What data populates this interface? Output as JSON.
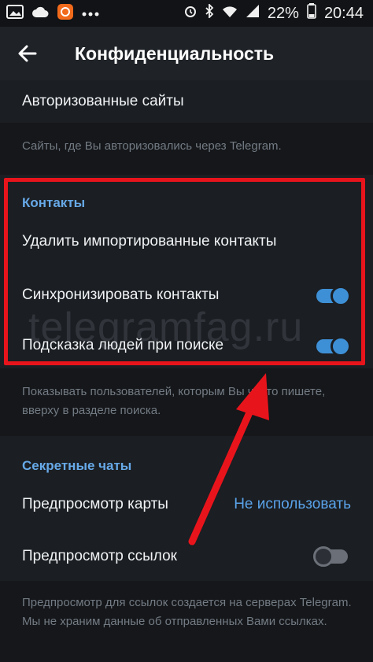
{
  "status_bar": {
    "battery": "22%",
    "time": "20:44"
  },
  "toolbar": {
    "title": "Конфиденциальность"
  },
  "authorized_sites": {
    "label": "Авторизованные сайты",
    "hint": "Сайты, где Вы авторизовались через Telegram."
  },
  "contacts": {
    "header": "Контакты",
    "delete_imported": "Удалить импортированные контакты",
    "sync_contacts": "Синхронизировать контакты",
    "sync_enabled": true,
    "suggest_people": "Подсказка людей при поиске",
    "suggest_enabled": true,
    "hint": "Показывать пользователей, которым Вы часто пишете, вверху в разделе поиска."
  },
  "secret_chats": {
    "header": "Секретные чаты",
    "map_preview": "Предпросмотр карты",
    "map_preview_value": "Не использовать",
    "link_preview": "Предпросмотр ссылок",
    "link_preview_enabled": false,
    "hint": "Предпросмотр для ссылок создается на серверах Telegram. Мы не храним данные об отправленных Вами ссылках."
  },
  "watermark": "telegramfag.ru",
  "colors": {
    "accent": "#3e90d6",
    "highlight": "#e8141c"
  }
}
